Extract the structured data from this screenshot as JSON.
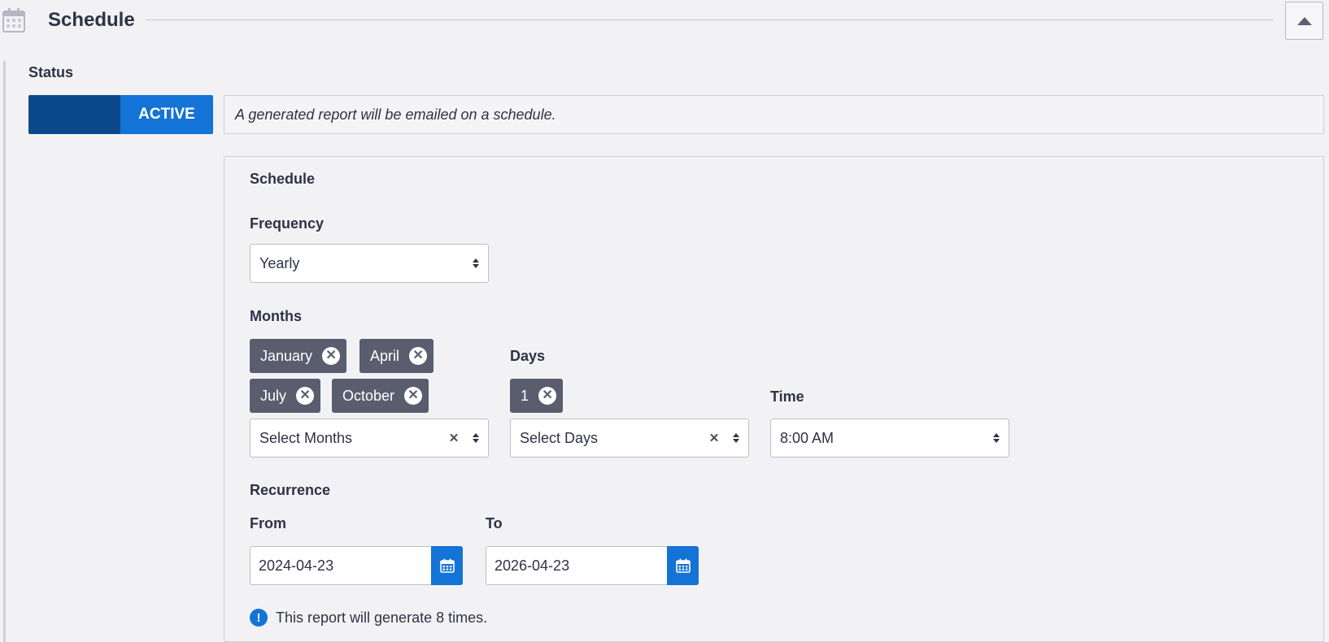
{
  "header": {
    "title": "Schedule",
    "icon": "calendar-icon",
    "collapse_icon": "caret-up-icon"
  },
  "status": {
    "label": "Status",
    "toggle_text": "ACTIVE",
    "description": "A generated report will be emailed on a schedule."
  },
  "schedule": {
    "title": "Schedule",
    "frequency": {
      "label": "Frequency",
      "value": "Yearly"
    },
    "months": {
      "label": "Months",
      "tags": [
        "January",
        "April",
        "July",
        "October"
      ],
      "placeholder": "Select Months"
    },
    "days": {
      "label": "Days",
      "tags": [
        "1"
      ],
      "placeholder": "Select Days"
    },
    "time": {
      "label": "Time",
      "value": "8:00 AM"
    },
    "recurrence": {
      "label": "Recurrence",
      "from_label": "From",
      "from_value": "2024-04-23",
      "to_label": "To",
      "to_value": "2026-04-23"
    },
    "info_text": "This report will generate 8 times."
  },
  "colors": {
    "accent": "#1473d6",
    "toggle_dark": "#0b4a8a",
    "tag_bg": "#5a5d6e",
    "background": "#f2f2f5"
  }
}
